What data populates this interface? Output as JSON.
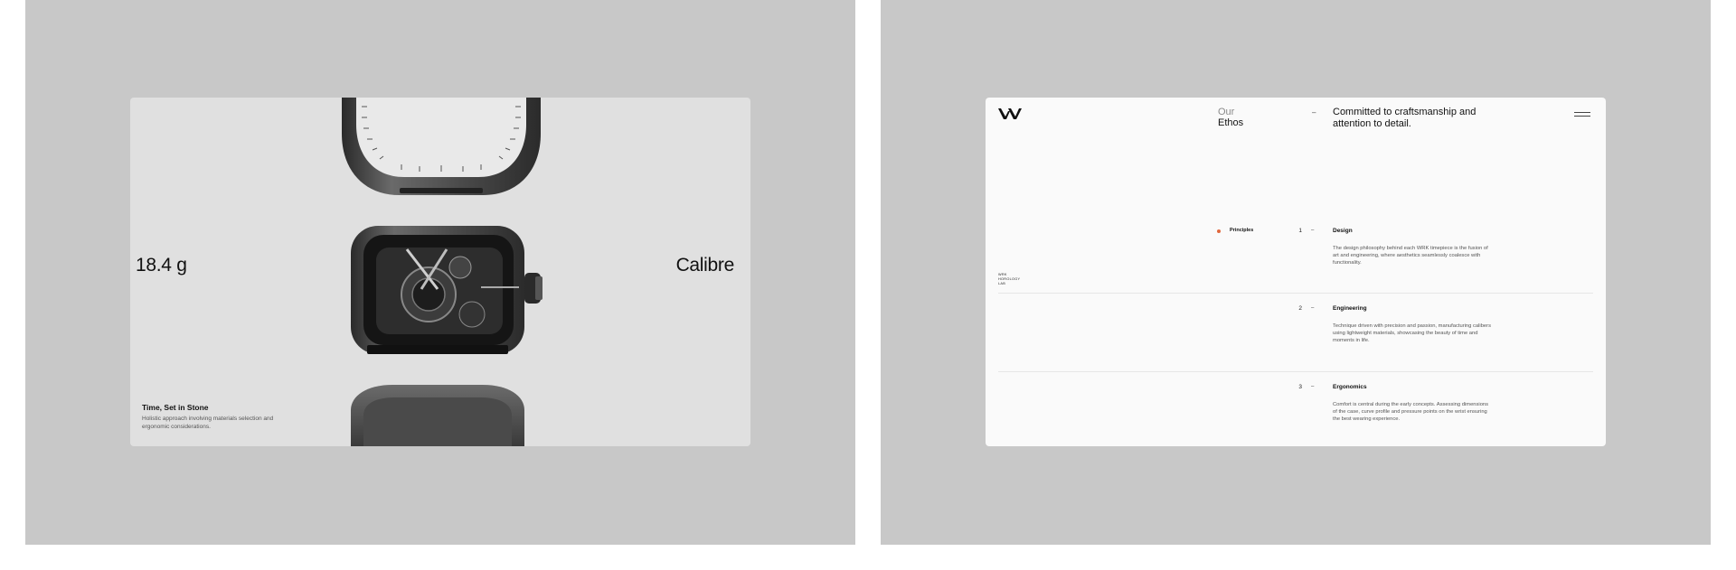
{
  "left_card": {
    "weight": "18.4 g",
    "calibre": "Calibre",
    "caption_title": "Time, Set in Stone",
    "caption_body": "Holistic approach involving materials selection and ergonomic considerations."
  },
  "right_card": {
    "logo": "WRK logo",
    "side_text": [
      "WRK",
      "HOROLOGY",
      "LAB"
    ],
    "ethos_kicker": "Our",
    "ethos_title": "Ethos",
    "header_dash": "–",
    "headline": "Committed to craftsmanship and attention to detail.",
    "section_label": "Principles",
    "accent_color": "#e0673c",
    "principles": [
      {
        "number": "1",
        "dash": "–",
        "title": "Design",
        "body": "The design philosophy behind each WRK timepiece is the fusion of art and engineering, where aesthetics seamlessly coalesce with functionality."
      },
      {
        "number": "2",
        "dash": "–",
        "title": "Engineering",
        "body": "Technique driven with precision and passion, manufacturing calibers using lightweight materials, showcasing the beauty of time and moments in life."
      },
      {
        "number": "3",
        "dash": "–",
        "title": "Ergonomics",
        "body": "Comfort is central during the early concepts. Assessing dimensions of the case, curve profile and pressure points on the wrist ensuring the best wearing experience."
      }
    ]
  }
}
